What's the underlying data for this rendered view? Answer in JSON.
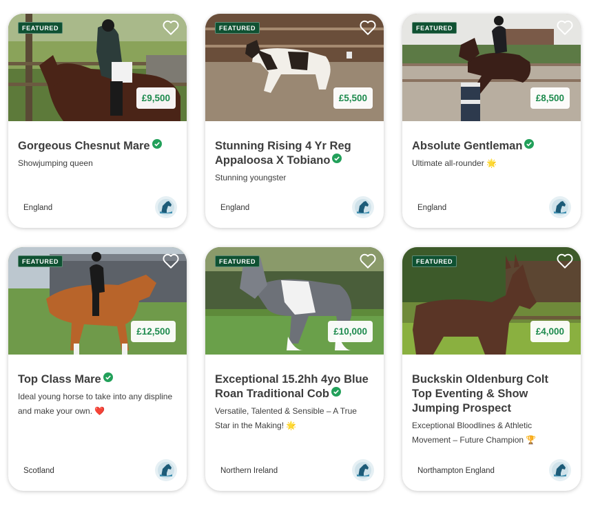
{
  "listings": [
    {
      "featured": "FEATURED",
      "price": "£9,500",
      "title": "Gorgeous Chesnut Mare",
      "description": "Showjumping queen",
      "location": "England"
    },
    {
      "featured": "FEATURED",
      "price": "£5,500",
      "title": "Stunning Rising 4 Yr Reg Appaloosa X Tobiano",
      "description": "Stunning youngster",
      "location": "England"
    },
    {
      "featured": "FEATURED",
      "price": "£8,500",
      "title": "Absolute Gentleman",
      "description": "Ultimate all-rounder 🌟",
      "location": "England"
    },
    {
      "featured": "FEATURED",
      "price": "£12,500",
      "title": "Top Class Mare",
      "description": "Ideal young horse to take into any displine and make your own. ❤️",
      "location": "Scotland"
    },
    {
      "featured": "FEATURED",
      "price": "£10,000",
      "title": "Exceptional 15.2hh 4yo Blue Roan Traditional Cob",
      "description": "Versatile, Talented & Sensible – A True Star in the Making! 🌟",
      "location": "Northern Ireland"
    },
    {
      "featured": "FEATURED",
      "price": "£4,000",
      "title": "Buckskin Oldenburg Colt Top Eventing & Show Jumping Prospect",
      "description": "Exceptional Bloodlines & Athletic Movement – Future Champion 🏆",
      "location": "Northampton England"
    }
  ],
  "colors": {
    "featured_badge": "#0f5132",
    "price_text": "#1d8a4d",
    "verified": "#22a05a"
  },
  "icons": {
    "favourite": "heart-outline-icon",
    "verified": "check-circle-icon",
    "seller": "horse-head-avatar-icon"
  }
}
